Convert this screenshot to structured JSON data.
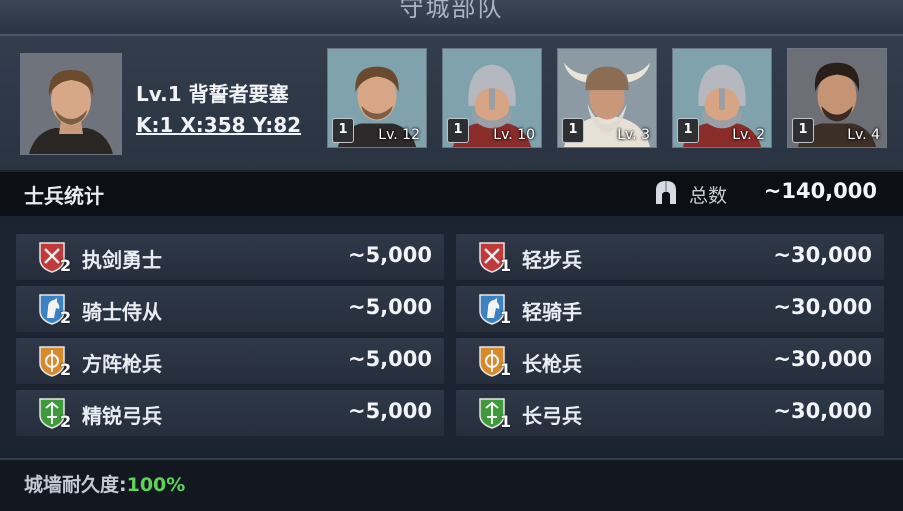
{
  "title": "守城部队",
  "commander": {
    "name": "Lv.1 背誓者要塞",
    "coords": "K:1 X:358 Y:82"
  },
  "heroes": [
    {
      "badge": "1",
      "level": "Lv. 12",
      "kind": "brown-hair-portrait"
    },
    {
      "badge": "1",
      "level": "Lv. 10",
      "kind": "helmet-portrait"
    },
    {
      "badge": "1",
      "level": "Lv. 3",
      "kind": "viking-portrait"
    },
    {
      "badge": "1",
      "level": "Lv. 2",
      "kind": "helmet-portrait"
    },
    {
      "badge": "1",
      "level": "Lv. 4",
      "kind": "dark-hair-portrait"
    }
  ],
  "stats": {
    "title": "士兵统计",
    "total_label": "总数",
    "total_value": "~140,000"
  },
  "troops": [
    {
      "name": "执剑勇士",
      "count": "~5,000",
      "tier": "2",
      "icon": "sword-shield-icon",
      "color": "#c0393b"
    },
    {
      "name": "轻步兵",
      "count": "~30,000",
      "tier": "1",
      "icon": "sword-shield-icon",
      "color": "#c0393b"
    },
    {
      "name": "骑士侍从",
      "count": "~5,000",
      "tier": "2",
      "icon": "horse-shield-icon",
      "color": "#3b82c4"
    },
    {
      "name": "轻骑手",
      "count": "~30,000",
      "tier": "1",
      "icon": "horse-shield-icon",
      "color": "#3b82c4"
    },
    {
      "name": "方阵枪兵",
      "count": "~5,000",
      "tier": "2",
      "icon": "spear-shield-icon",
      "color": "#d68a2c"
    },
    {
      "name": "长枪兵",
      "count": "~30,000",
      "tier": "1",
      "icon": "spear-shield-icon",
      "color": "#d68a2c"
    },
    {
      "name": "精锐弓兵",
      "count": "~5,000",
      "tier": "2",
      "icon": "bow-shield-icon",
      "color": "#3f9a3c"
    },
    {
      "name": "长弓兵",
      "count": "~30,000",
      "tier": "1",
      "icon": "bow-shield-icon",
      "color": "#3f9a3c"
    }
  ],
  "wall": {
    "label": "城墙耐久度:",
    "value": "100%"
  }
}
